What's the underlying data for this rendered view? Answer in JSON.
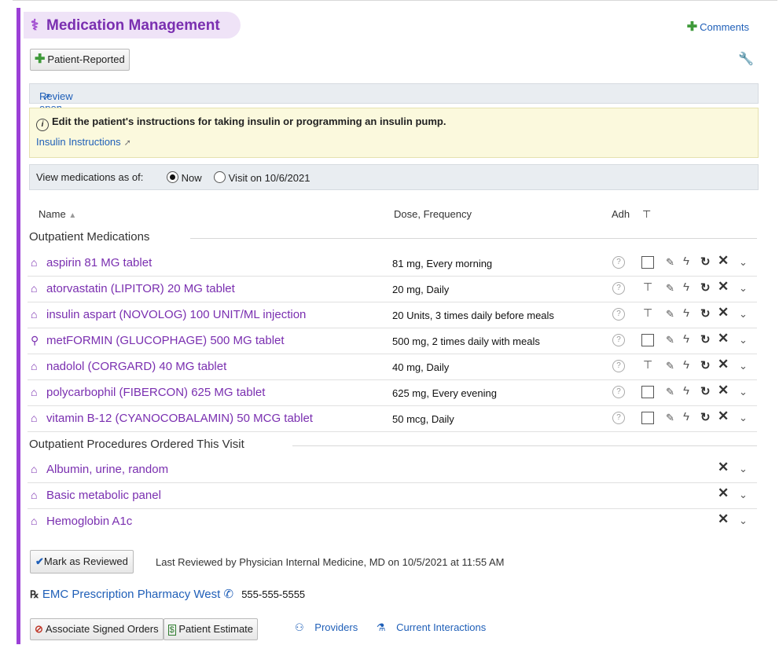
{
  "header": {
    "title": "Medication Management",
    "comments_label": "Comments"
  },
  "toolbar": {
    "patient_reported_label": "Patient-Reported"
  },
  "review_orders": {
    "label": "Review open orders"
  },
  "insulin_note": {
    "text": "Edit the patient's instructions for taking insulin or programming an insulin pump.",
    "link": "Insulin Instructions"
  },
  "view_as_of": {
    "label": "View medications as of:",
    "options": [
      "Now",
      "Visit on 10/6/2021"
    ],
    "selected": "Now"
  },
  "columns": {
    "name": "Name",
    "dose": "Dose, Frequency",
    "adh": "Adh"
  },
  "outpatient_medications": {
    "heading": "Outpatient Medications",
    "items": [
      {
        "name": "aspirin 81 MG tablet",
        "dose": "81 mg, Every morning",
        "marker": "checkbox"
      },
      {
        "name": "atorvastatin (LIPITOR) 20 MG tablet",
        "dose": "20 mg, Daily",
        "marker": "pin"
      },
      {
        "name": "insulin aspart (NOVOLOG) 100 UNIT/ML injection",
        "dose": "20 Units, 3 times daily before meals",
        "marker": "pin"
      },
      {
        "name": "metFORMIN (GLUCOPHAGE) 500 MG tablet",
        "dose": "500 mg, 2 times daily with meals",
        "marker": "checkbox"
      },
      {
        "name": "nadolol (CORGARD) 40 MG tablet",
        "dose": "40 mg, Daily",
        "marker": "pin"
      },
      {
        "name": "polycarbophil (FIBERCON) 625 MG tablet",
        "dose": "625 mg, Every evening",
        "marker": "checkbox"
      },
      {
        "name": "vitamin B-12 (CYANOCOBALAMIN) 50 MCG tablet",
        "dose": "50 mcg, Daily",
        "marker": "checkbox"
      }
    ]
  },
  "outpatient_procedures": {
    "heading": "Outpatient Procedures Ordered This Visit",
    "items": [
      {
        "name": "Albumin, urine, random"
      },
      {
        "name": "Basic metabolic panel"
      },
      {
        "name": "Hemoglobin A1c"
      }
    ]
  },
  "review": {
    "button_label": "Mark as Reviewed",
    "last_reviewed": "Last Reviewed by Physician Internal Medicine, MD on 10/5/2021 at 11:55 AM"
  },
  "pharmacy": {
    "name": "EMC Prescription Pharmacy West",
    "phone": "555-555-5555"
  },
  "bottom": {
    "associate_label": "Associate Signed Orders",
    "estimate_label": "Patient Estimate",
    "providers_label": "Providers",
    "interactions_label": "Current Interactions"
  }
}
